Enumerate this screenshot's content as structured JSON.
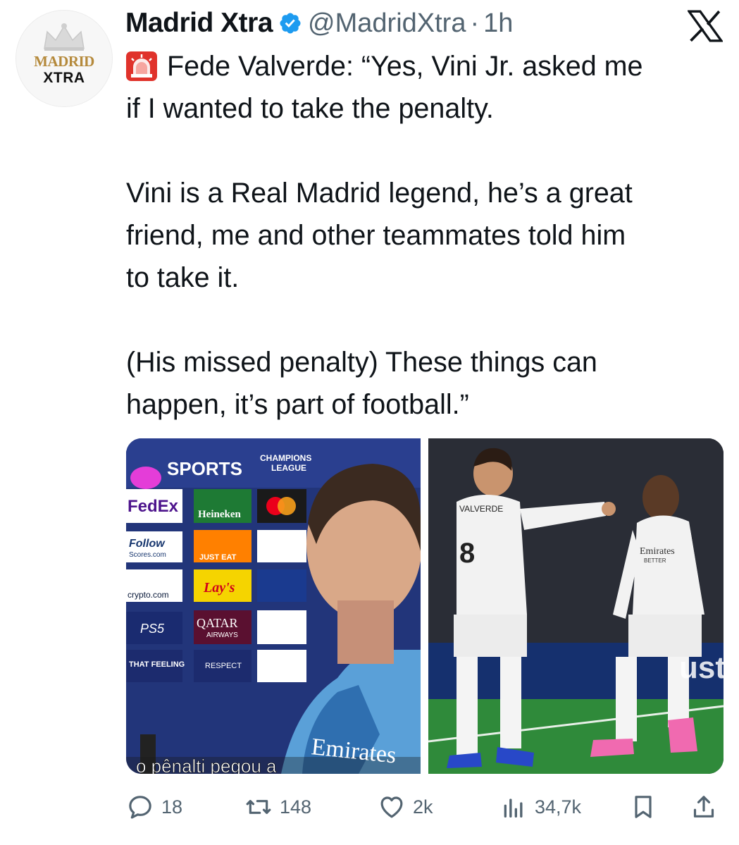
{
  "account": {
    "display_name": "Madrid Xtra",
    "handle": "@MadridXtra",
    "separator": "·",
    "time_ago": "1h",
    "avatar_text_top": "MADRID",
    "avatar_text_bottom": "XTRA",
    "verified_icon": "verified-badge-icon"
  },
  "platform_logo": "x-logo-icon",
  "tweet": {
    "emoji": "siren-icon",
    "line1": "Fede Valverde: “Yes, Vini Jr. asked me\nif I wanted to take the penalty.\n\nVini is a Real Madrid legend, he’s a great\nfriend, me and other teammates told him\nto take it.\n\n(His missed penalty) These things can\nhappen, it’s part of football.”"
  },
  "media": {
    "photo1": {
      "broadcaster": "SPORTS",
      "competition_top": "CHAMPIONS",
      "competition_bottom": "LEAGUE",
      "board_fedex": "FedEx",
      "board_heineken": "Heineken",
      "board_follow": "Follow",
      "board_follow_sub": "Scores.com",
      "board_justeat": "JUST EAT",
      "board_lays": "Lay's",
      "board_crypto": "crypto.com",
      "board_ps5": "PS5",
      "board_qatar": "QATAR",
      "board_qatar_sub": "AIRWAYS",
      "board_respect": "RESPECT",
      "board_that_feeling": "THAT FEELING",
      "shirt_sponsor": "Emirates",
      "subtitle": "o pênalti pegou a"
    },
    "photo2": {
      "shirt_name": "VALVERDE",
      "shirt_number": "8",
      "sponsor": "Emirates",
      "sponsor_sub": "BETTER",
      "board_text": "uste"
    }
  },
  "actions": {
    "replies": "18",
    "reposts": "148",
    "likes": "2k",
    "views": "34,7k"
  },
  "colors": {
    "text": "#0f1419",
    "secondary": "#536471",
    "verified": "#1d9bf0",
    "gold": "#b58a3c",
    "siren_red": "#e0322b"
  }
}
